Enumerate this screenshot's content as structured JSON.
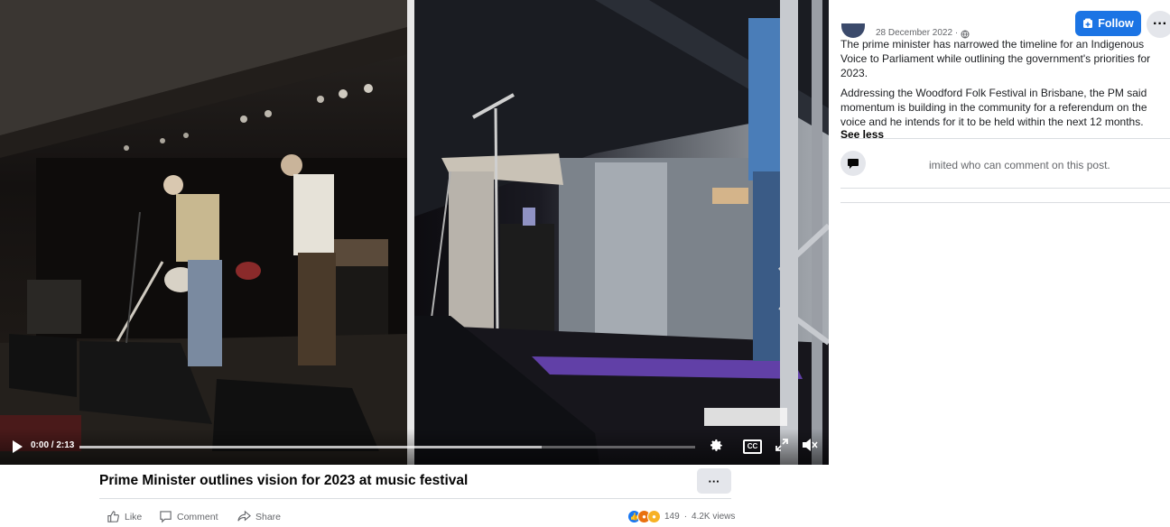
{
  "video": {
    "time_label": "0:00 / 2:13",
    "progress_fraction": 0.0,
    "buffered_fraction": 0.75,
    "cc_label": "CC",
    "icons": {
      "play": "play-icon",
      "settings": "gear-icon",
      "fullscreen": "fullscreen-icon",
      "volume": "volume-muted-icon"
    }
  },
  "post": {
    "date": "28 December 2022 ·",
    "follow_label": "Follow",
    "more_label": "···",
    "paragraph_1": "The prime minister has narrowed the timeline for an Indigenous Voice to Parliament while outlining the government's priorities for 2023.",
    "paragraph_2": "Addressing the Woodford Folk Festival in Brisbane, the PM said momentum is building in the community for a referendum on the voice and he intends for it to be held within the next 12 months.",
    "see_less": "See less",
    "comment_notice": "imited who can comment on this post."
  },
  "footer": {
    "title": "Prime Minister outlines vision for 2023 at music festival",
    "more_label": "···",
    "like_label": "Like",
    "comment_label": "Comment",
    "share_label": "Share",
    "reaction_count": "149",
    "dot": "·",
    "views": "4.2K views"
  },
  "colors": {
    "follow_blue": "#1b74e4",
    "like_blue": "#1877f2",
    "stage_purple": "#7b4fd6"
  }
}
